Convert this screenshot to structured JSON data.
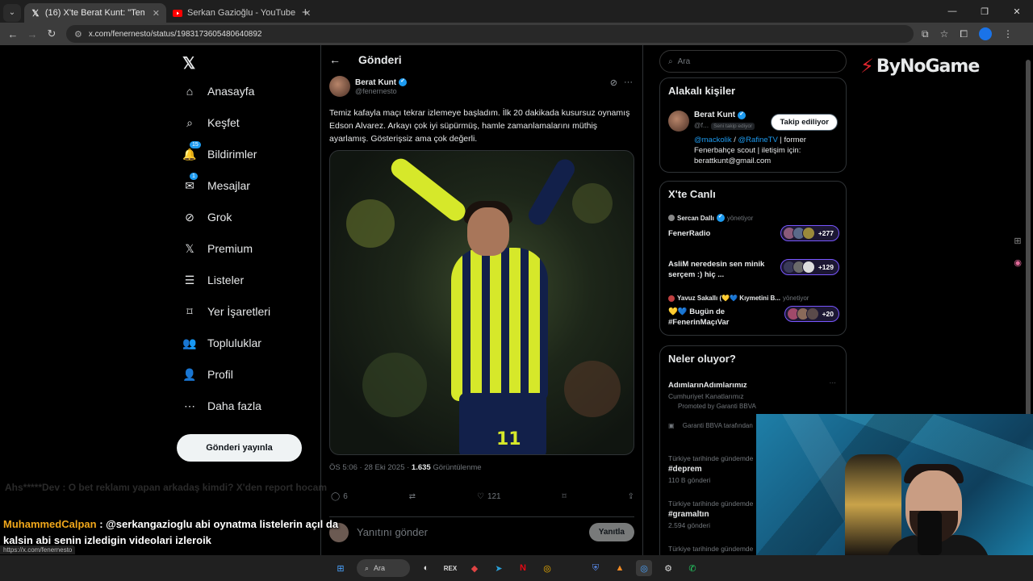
{
  "browser": {
    "tabs": [
      {
        "title": "(16) X'te Berat Kunt: \"Temiz kaf...",
        "favicon": "x-icon",
        "active": true
      },
      {
        "title": "Serkan Gazioğlu - YouTube",
        "favicon": "youtube-icon",
        "active": false
      }
    ],
    "url": "x.com/fenernesto/status/1983173605480640892"
  },
  "nav": {
    "items": [
      {
        "label": "Anasayfa",
        "icon": "home-icon"
      },
      {
        "label": "Keşfet",
        "icon": "search-icon"
      },
      {
        "label": "Bildirimler",
        "icon": "bell-icon",
        "badge": "15"
      },
      {
        "label": "Mesajlar",
        "icon": "mail-icon",
        "badge": "1"
      },
      {
        "label": "Grok",
        "icon": "grok-icon"
      },
      {
        "label": "Premium",
        "icon": "x-premium-icon"
      },
      {
        "label": "Listeler",
        "icon": "list-icon"
      },
      {
        "label": "Yer İşaretleri",
        "icon": "bookmark-icon"
      },
      {
        "label": "Topluluklar",
        "icon": "communities-icon"
      },
      {
        "label": "Profil",
        "icon": "profile-icon"
      },
      {
        "label": "Daha fazla",
        "icon": "more-icon"
      }
    ],
    "post_button": "Gönderi yayınla"
  },
  "post": {
    "header": "Gönderi",
    "author_name": "Berat Kunt",
    "author_handle": "@fenernesto",
    "text": "Temiz kafayla maçı tekrar izlemeye başladım. İlk 20 dakikada kusursuz oynamış Edson Alvarez. Arkayı çok iyi süpürmüş, hamle zamanlamalarını müthiş ayarlamış. Gösterişsiz ama çok değerli.",
    "time": "ÖS 5:06 · 28 Eki 2025 · ",
    "views": "1.635",
    "views_label": " Görüntülenme",
    "replies": "6",
    "likes": "121",
    "reply_placeholder": "Yanıtını gönder",
    "reply_button": "Yanıtla"
  },
  "right": {
    "search_placeholder": "Ara",
    "related": {
      "title": "Alakalı kişiler",
      "name": "Berat Kunt",
      "handle": "@f...",
      "follows_tag": "Seni takip ediyor",
      "follow_button": "Takip ediliyor",
      "bio_link1": "@mackolik",
      "bio_sep": " / ",
      "bio_link2": "@RafineTV",
      "bio_rest": " | former Fenerbahçe scout | iletişim için: berattkunt@gmail.com"
    },
    "live": {
      "title": "X'te Canlı",
      "items": [
        {
          "host": "Sercan Dallı",
          "role": "yönetiyor",
          "title": "FenerRadio",
          "count": "+277"
        },
        {
          "host": "",
          "role": "",
          "title": "AsliM neredesin sen minik serçem :) hiç ...",
          "count": "+129"
        },
        {
          "host": "Yavuz Sakallı (💛💙 Kıymetini B...",
          "role": "yönetiyor",
          "title": "💛💙 Bugün de #FenerinMaçıVar",
          "count": "+20"
        }
      ]
    },
    "trends": {
      "title": "Neler oluyor?",
      "promo_title": "AdımlarınAdımlarımız",
      "promo_sub": "Cumhuriyet Kanatlarımız",
      "promo_by": "Promoted by Garanti BBVA",
      "promo_ad": "Garanti BBVA tarafından",
      "items": [
        {
          "context": "Türkiye tarihinde gündemde",
          "tag": "#deprem",
          "count": "110 B gönderi"
        },
        {
          "context": "Türkiye tarihinde gündemde",
          "tag": "#gramaltın",
          "count": "2.594 gönderi"
        },
        {
          "context": "Türkiye tarihinde gündemde",
          "tag": "",
          "count": ""
        }
      ]
    }
  },
  "overlay": {
    "brand": "ByNoGame",
    "chat_ghost": "Ahs*****Dev : O bet reklamı yapan arkadaş kimdi? X'den report hocam",
    "chat_user": "MuhammedCalpan",
    "chat_message": " : @serkangazioglu abi oynatma listelerin açıl da kalsin abi senin izledigin videolari izleroik",
    "status_url": "https://x.com/fenernesto"
  },
  "taskbar": {
    "search_label": "Ara"
  },
  "colors": {
    "accent": "#1d9bf0",
    "brand_red": "#e0262e",
    "live_purple": "#7856ff",
    "chat_username": "#f0a71b"
  }
}
